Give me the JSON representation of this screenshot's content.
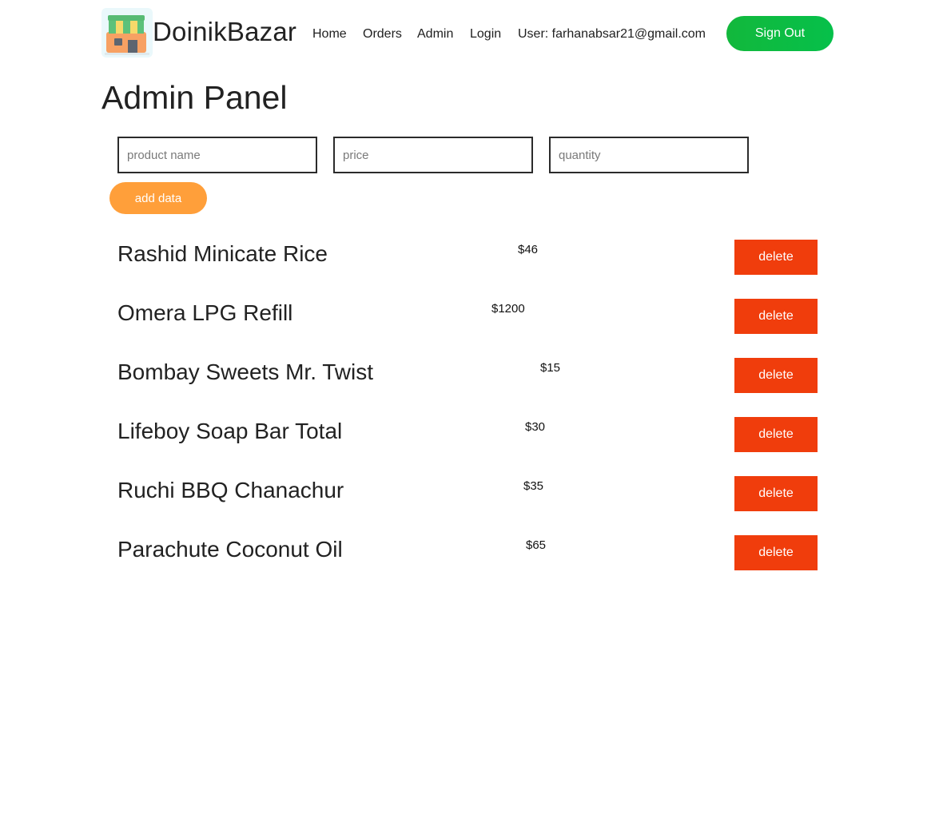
{
  "header": {
    "brand": "DoinikBazar",
    "logo_icon": "shop-storefront-icon",
    "nav": [
      "Home",
      "Orders",
      "Admin",
      "Login"
    ],
    "user_label": "User: farhanabsar21@gmail.com",
    "signout_label": "Sign Out",
    "colors": {
      "signout": "#0bbd42"
    }
  },
  "page": {
    "title": "Admin Panel"
  },
  "form": {
    "name_placeholder": "product name",
    "price_placeholder": "price",
    "quantity_placeholder": "quantity",
    "add_label": "add data",
    "colors": {
      "add": "#ff9f3a"
    }
  },
  "products": [
    {
      "name": "Rashid Minicate Rice",
      "price": "$46",
      "delete_label": "delete"
    },
    {
      "name": "Omera LPG Refill",
      "price": "$1200",
      "delete_label": "delete"
    },
    {
      "name": "Bombay Sweets Mr. Twist",
      "price": "$15",
      "delete_label": "delete"
    },
    {
      "name": "Lifeboy Soap Bar Total",
      "price": "$30",
      "delete_label": "delete"
    },
    {
      "name": "Ruchi BBQ Chanachur",
      "price": "$35",
      "delete_label": "delete"
    },
    {
      "name": "Parachute Coconut Oil",
      "price": "$65",
      "delete_label": "delete"
    }
  ],
  "colors": {
    "delete": "#f03d0c"
  }
}
